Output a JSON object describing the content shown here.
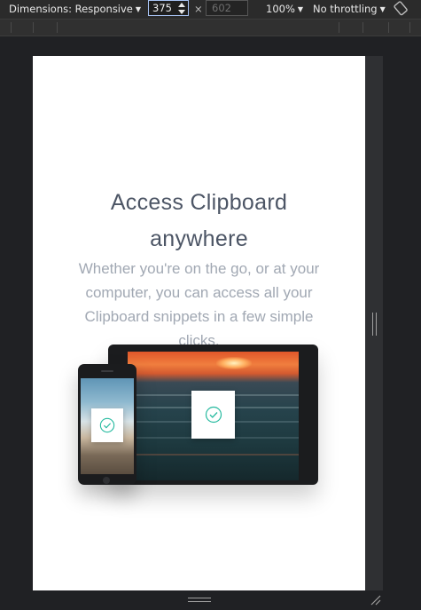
{
  "devtools": {
    "dimensions_label": "Dimensions: Responsive",
    "width_value": "375",
    "times_symbol": "×",
    "height_placeholder": "602",
    "zoom_label": "100%",
    "throttle_label": "No throttling",
    "caret": "▼"
  },
  "page": {
    "headline_line1": "Access Clipboard",
    "headline_line2": "anywhere",
    "copy": "Whether you're on the go, or at your computer, you can access all your Clipboard snippets in a few simple clicks,"
  },
  "colors": {
    "headline": "#4c5565",
    "copy": "#a1a8b3",
    "check_accent": "#26ba9f"
  },
  "icons": {
    "rotate": "rotate-device-icon",
    "checkmark": "check-circle-icon"
  }
}
